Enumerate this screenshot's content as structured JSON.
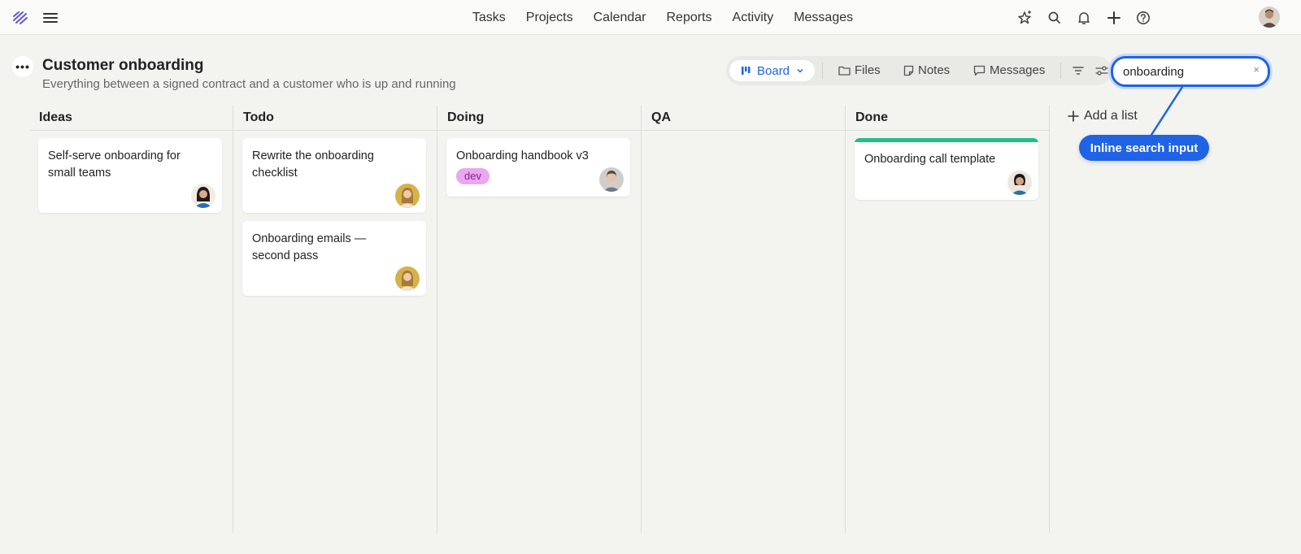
{
  "nav": {
    "items": [
      "Tasks",
      "Projects",
      "Calendar",
      "Reports",
      "Activity",
      "Messages"
    ]
  },
  "header": {
    "title": "Customer onboarding",
    "subtitle": "Everything between a signed contract and a customer who is up and running"
  },
  "toolbar": {
    "view_label": "Board",
    "files_label": "Files",
    "notes_label": "Notes",
    "messages_label": "Messages"
  },
  "search": {
    "value": "onboarding",
    "clear_label": "×"
  },
  "callout": {
    "label": "Inline search input"
  },
  "columns": [
    {
      "title": "Ideas",
      "cards": [
        {
          "title": "Self-serve onboarding for small teams"
        }
      ]
    },
    {
      "title": "Todo",
      "cards": [
        {
          "title": "Rewrite the onboarding checklist"
        },
        {
          "title": "Onboarding emails — second pass"
        }
      ]
    },
    {
      "title": "Doing",
      "cards": [
        {
          "title": "Onboarding handbook v3",
          "tag": "dev"
        }
      ]
    },
    {
      "title": "QA",
      "cards": []
    },
    {
      "title": "Done",
      "cards": [
        {
          "title": "Onboarding call template"
        }
      ]
    }
  ],
  "add_list_label": "Add a list",
  "colors": {
    "accent": "#1f63e6",
    "done_bar": "#1fbf8a",
    "tag_bg": "#e9a8f0",
    "tag_text": "#8a1f96",
    "logo": "#5b5bd6"
  },
  "icons": {
    "logo": "logo-icon",
    "menu": "hamburger-icon",
    "sparkle_star": "sparkle-star-icon",
    "search": "search-icon",
    "bell": "bell-icon",
    "plus": "plus-icon",
    "help": "help-icon",
    "board": "board-icon",
    "folder": "folder-icon",
    "note": "note-icon",
    "chat": "chat-icon",
    "filter": "filter-icon",
    "options": "options-icon"
  }
}
